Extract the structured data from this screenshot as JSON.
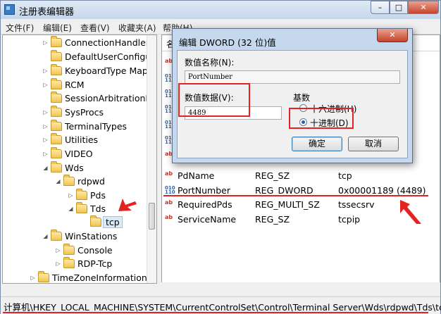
{
  "window": {
    "title": "注册表编辑器",
    "min_glyph": "–",
    "max_glyph": "□",
    "close_glyph": "✕"
  },
  "menu": [
    {
      "label": "文件(F)"
    },
    {
      "label": "编辑(E)"
    },
    {
      "label": "查看(V)"
    },
    {
      "label": "收藏夹(A)"
    },
    {
      "label": "帮助(H)"
    }
  ],
  "tree": {
    "items": [
      {
        "label": "ConnectionHandler"
      },
      {
        "label": "DefaultUserConfigur"
      },
      {
        "label": "KeyboardType Map"
      },
      {
        "label": "RCM"
      },
      {
        "label": "SessionArbitrationH"
      },
      {
        "label": "SysProcs"
      },
      {
        "label": "TerminalTypes"
      },
      {
        "label": "Utilities"
      },
      {
        "label": "VIDEO"
      },
      {
        "label": "Wds"
      },
      {
        "label": "rdpwd"
      },
      {
        "label": "Pds"
      },
      {
        "label": "Tds"
      },
      {
        "label": "tcp"
      },
      {
        "label": "WinStations"
      },
      {
        "label": "Console"
      },
      {
        "label": "RDP-Tcp"
      },
      {
        "label": "TimeZoneInformation"
      }
    ]
  },
  "list": {
    "header_name": "名",
    "rows": [
      {
        "name": "PdName",
        "type": "REG_SZ",
        "data": "tcp",
        "icon": "string-value-icon"
      },
      {
        "name": "PortNumber",
        "type": "REG_DWORD",
        "data": "0x00001189 (4489)",
        "icon": "binary-value-icon"
      },
      {
        "name": "RequiredPds",
        "type": "REG_MULTI_SZ",
        "data": "tssecsrv",
        "icon": "string-value-icon"
      },
      {
        "name": "ServiceName",
        "type": "REG_SZ",
        "data": "tcpip",
        "icon": "string-value-icon"
      }
    ]
  },
  "status": {
    "path": "计算机\\HKEY_LOCAL_MACHINE\\SYSTEM\\CurrentControlSet\\Control\\Terminal Server\\Wds\\rdpwd\\Tds\\tcp"
  },
  "dialog": {
    "title": "编辑 DWORD (32 位)值",
    "name_label": "数值名称(N):",
    "name_value": "PortNumber",
    "data_label": "数值数据(V):",
    "data_value": "4489",
    "base_label": "基数",
    "hex_label": "十六进制(H)",
    "dec_label": "十进制(D)",
    "selected_base": "decimal",
    "ok_label": "确定",
    "cancel_label": "取消"
  },
  "annotation_color": "#e32222"
}
